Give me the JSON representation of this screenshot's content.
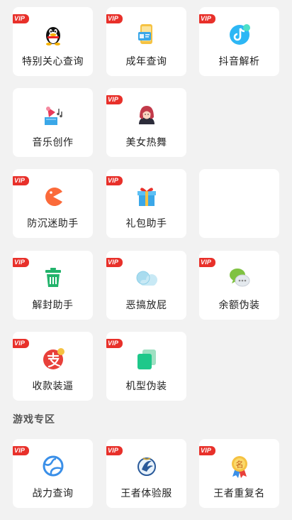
{
  "vip_badge": "VIP",
  "colors": {
    "vip": "#e8302a",
    "card": "#ffffff",
    "background": "#f2f2f2"
  },
  "tools": [
    {
      "label": "特别关心查询",
      "icon": "qq-penguin-icon",
      "vip": true
    },
    {
      "label": "成年查询",
      "icon": "id-card-phone-icon",
      "vip": true
    },
    {
      "label": "抖音解析",
      "icon": "tiktok-icon",
      "vip": true
    },
    {
      "label": "音乐创作",
      "icon": "gramophone-icon",
      "vip": false
    },
    {
      "label": "美女热舞",
      "icon": "girl-avatar-icon",
      "vip": true
    },
    {
      "label": "防沉迷助手",
      "icon": "pacman-icon",
      "vip": true
    },
    {
      "label": "礼包助手",
      "icon": "gift-box-icon",
      "vip": true
    },
    {
      "label": "解封助手",
      "icon": "trash-bin-icon",
      "vip": true
    },
    {
      "label": "恶搞放屁",
      "icon": "cloud-icon",
      "vip": true
    },
    {
      "label": "余额伪装",
      "icon": "chat-bubbles-icon",
      "vip": true
    },
    {
      "label": "收款装逼",
      "icon": "alipay-icon",
      "vip": true
    },
    {
      "label": "机型伪装",
      "icon": "phone-layers-icon",
      "vip": true
    }
  ],
  "game_section": {
    "title": "游戏专区",
    "items": [
      {
        "label": "战力查询",
        "icon": "globe-icon",
        "vip": true
      },
      {
        "label": "王者体验服",
        "icon": "kings-emblem-icon",
        "vip": true
      },
      {
        "label": "王者重复名",
        "icon": "name-medal-icon",
        "vip": true
      }
    ]
  }
}
